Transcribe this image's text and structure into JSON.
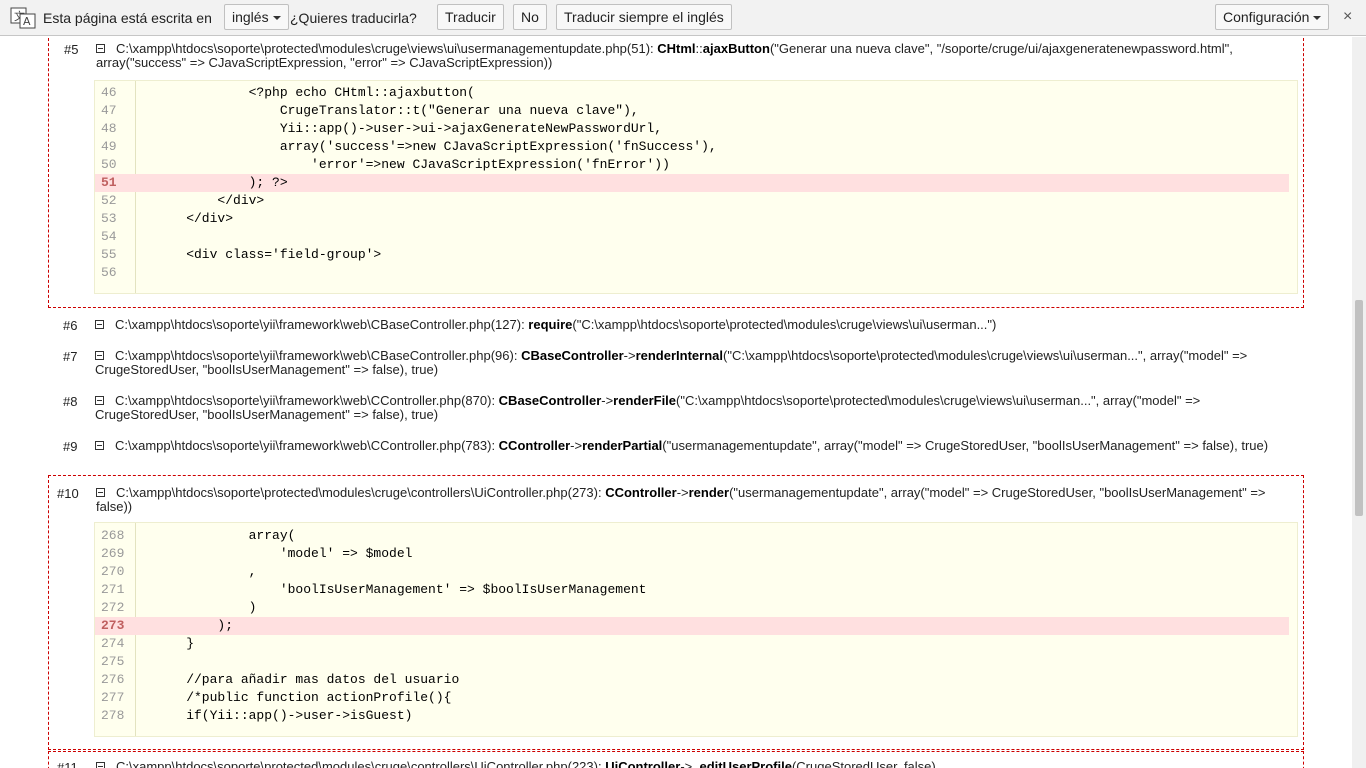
{
  "translate_bar": {
    "message": "Esta página está escrita en",
    "language": "inglés",
    "question": "¿Quieres traducirla?",
    "translate_label": "Traducir",
    "no_label": "No",
    "always_label": "Traducir siempre el inglés",
    "settings_label": "Configuración",
    "close_label": "×"
  },
  "traces": [
    {
      "num": "#5",
      "parts": [
        {
          "t": "C:\\xampp\\htdocs\\soporte\\protected\\modules\\cruge\\views\\ui\\usermanagementupdate.php(51): "
        },
        {
          "t": "CHtml",
          "b": true
        },
        {
          "t": "::"
        },
        {
          "t": "ajaxButton",
          "b": true
        },
        {
          "t": "(\"Generar una nueva clave\", \"/soporte/cruge/ui/ajaxgeneratenewpassword.html\", array(\"success\" => CJavaScriptExpression, \"error\" => CJavaScriptExpression))"
        }
      ],
      "code": [
        {
          "ln": "46",
          "tx": "            <?php echo CHtml::ajaxbutton("
        },
        {
          "ln": "47",
          "tx": "                CrugeTranslator::t(\"Generar una nueva clave\"),"
        },
        {
          "ln": "48",
          "tx": "                Yii::app()->user->ui->ajaxGenerateNewPasswordUrl,"
        },
        {
          "ln": "49",
          "tx": "                array('success'=>new CJavaScriptExpression('fnSuccess'),"
        },
        {
          "ln": "50",
          "tx": "                    'error'=>new CJavaScriptExpression('fnError'))"
        },
        {
          "ln": "51",
          "tx": "            ); ?>"
        },
        {
          "ln": "52",
          "tx": "        </div>"
        },
        {
          "ln": "53",
          "tx": "    </div>"
        },
        {
          "ln": "54",
          "tx": ""
        },
        {
          "ln": "55",
          "tx": "    <div class='field-group'>"
        },
        {
          "ln": "56",
          "tx": ""
        }
      ]
    },
    {
      "num": "#6",
      "parts": [
        {
          "t": "C:\\xampp\\htdocs\\soporte\\yii\\framework\\web\\CBaseController.php(127): "
        },
        {
          "t": "require",
          "b": true
        },
        {
          "t": "(\"C:\\xampp\\htdocs\\soporte\\protected\\modules\\cruge\\views\\ui\\userman...\")"
        }
      ]
    },
    {
      "num": "#7",
      "parts": [
        {
          "t": "C:\\xampp\\htdocs\\soporte\\yii\\framework\\web\\CBaseController.php(96): "
        },
        {
          "t": "CBaseController",
          "b": true
        },
        {
          "t": "->"
        },
        {
          "t": "renderInternal",
          "b": true
        },
        {
          "t": "(\"C:\\xampp\\htdocs\\soporte\\protected\\modules\\cruge\\views\\ui\\userman...\", array(\"model\" => CrugeStoredUser, \"boolIsUserManagement\" => false), true)"
        }
      ]
    },
    {
      "num": "#8",
      "parts": [
        {
          "t": "C:\\xampp\\htdocs\\soporte\\yii\\framework\\web\\CController.php(870): "
        },
        {
          "t": "CBaseController",
          "b": true
        },
        {
          "t": "->"
        },
        {
          "t": "renderFile",
          "b": true
        },
        {
          "t": "(\"C:\\xampp\\htdocs\\soporte\\protected\\modules\\cruge\\views\\ui\\userman...\", array(\"model\" => CrugeStoredUser, \"boolIsUserManagement\" => false), true)"
        }
      ]
    },
    {
      "num": "#9",
      "parts": [
        {
          "t": "C:\\xampp\\htdocs\\soporte\\yii\\framework\\web\\CController.php(783): "
        },
        {
          "t": "CController",
          "b": true
        },
        {
          "t": "->"
        },
        {
          "t": "renderPartial",
          "b": true
        },
        {
          "t": "(\"usermanagementupdate\", array(\"model\" => CrugeStoredUser, \"boolIsUserManagement\" => false), true)"
        }
      ]
    },
    {
      "num": "#10",
      "parts": [
        {
          "t": "C:\\xampp\\htdocs\\soporte\\protected\\modules\\cruge\\controllers\\UiController.php(273): "
        },
        {
          "t": "CController",
          "b": true
        },
        {
          "t": "->"
        },
        {
          "t": "render",
          "b": true
        },
        {
          "t": "(\"usermanagementupdate\", array(\"model\" => CrugeStoredUser, \"boolIsUserManagement\" => false))"
        }
      ],
      "code": [
        {
          "ln": "268",
          "tx": "            array("
        },
        {
          "ln": "269",
          "tx": "                'model' => $model"
        },
        {
          "ln": "270",
          "tx": "            ,"
        },
        {
          "ln": "271",
          "tx": "                'boolIsUserManagement' => $boolIsUserManagement"
        },
        {
          "ln": "272",
          "tx": "            )"
        },
        {
          "ln": "273",
          "tx": "        );"
        },
        {
          "ln": "274",
          "tx": "    }"
        },
        {
          "ln": "275",
          "tx": ""
        },
        {
          "ln": "276",
          "tx": "    //para añadir mas datos del usuario"
        },
        {
          "ln": "277",
          "tx": "    /*public function actionProfile(){"
        },
        {
          "ln": "278",
          "tx": "    if(Yii::app()->user->isGuest)"
        }
      ]
    },
    {
      "num": "#11",
      "parts": [
        {
          "t": "C:\\xampp\\htdocs\\soporte\\protected\\modules\\cruge\\controllers\\UiController.php(223): "
        },
        {
          "t": "UiController",
          "b": true
        },
        {
          "t": "->"
        },
        {
          "t": "_editUserProfile",
          "b": true
        },
        {
          "t": "(CrugeStoredUser, false)"
        }
      ]
    }
  ],
  "highlighted_lines": [
    "51",
    "273"
  ]
}
